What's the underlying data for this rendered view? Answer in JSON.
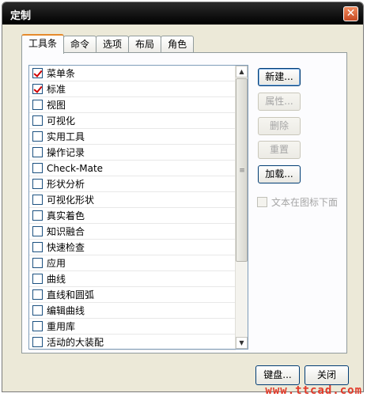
{
  "window": {
    "title": "定制"
  },
  "tabs": [
    {
      "label": "工具条",
      "active": true
    },
    {
      "label": "命令",
      "active": false
    },
    {
      "label": "选项",
      "active": false
    },
    {
      "label": "布局",
      "active": false
    },
    {
      "label": "角色",
      "active": false
    }
  ],
  "toolbar_list": {
    "items": [
      {
        "label": "菜单条",
        "checked": true
      },
      {
        "label": "标准",
        "checked": true
      },
      {
        "label": "视图",
        "checked": false
      },
      {
        "label": "可视化",
        "checked": false
      },
      {
        "label": "实用工具",
        "checked": false
      },
      {
        "label": "操作记录",
        "checked": false
      },
      {
        "label": "Check-Mate",
        "checked": false
      },
      {
        "label": "形状分析",
        "checked": false
      },
      {
        "label": "可视化形状",
        "checked": false
      },
      {
        "label": "真实着色",
        "checked": false
      },
      {
        "label": "知识融合",
        "checked": false
      },
      {
        "label": "快速检查",
        "checked": false
      },
      {
        "label": "应用",
        "checked": false
      },
      {
        "label": "曲线",
        "checked": false
      },
      {
        "label": "直线和圆弧",
        "checked": false
      },
      {
        "label": "编辑曲线",
        "checked": false
      },
      {
        "label": "重用库",
        "checked": false
      },
      {
        "label": "活动的大装配",
        "checked": false
      }
    ]
  },
  "side_buttons": {
    "new": {
      "label": "新建...",
      "enabled": true
    },
    "properties": {
      "label": "属性...",
      "enabled": false
    },
    "delete": {
      "label": "删除",
      "enabled": false
    },
    "reset": {
      "label": "重置",
      "enabled": false
    },
    "load": {
      "label": "加载...",
      "enabled": true
    }
  },
  "text_below_icon": {
    "label": "文本在图标下面",
    "checked": false,
    "enabled": false
  },
  "bottom_buttons": {
    "keyboard": "键盘...",
    "close": "关闭"
  },
  "watermark": "www.ttcad.com",
  "colors": {
    "accent_tab": "#e68b2c",
    "check_mark": "#d00000",
    "title_bar": "#000000"
  }
}
